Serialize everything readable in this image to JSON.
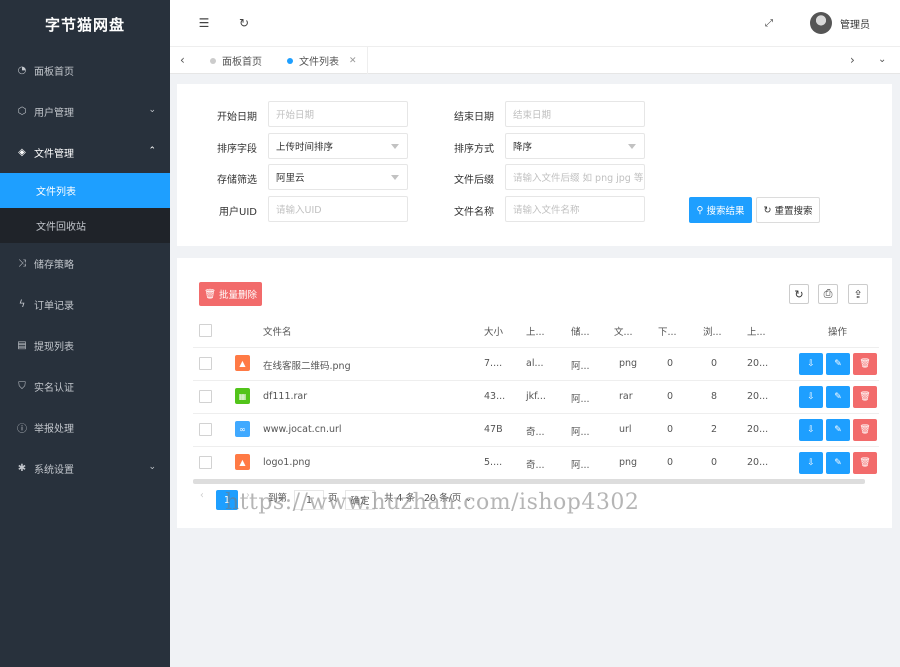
{
  "app": {
    "title": "字节猫网盘"
  },
  "sidebar": {
    "items": [
      {
        "label": "面板首页",
        "icon": "dashboard-icon"
      },
      {
        "label": "用户管理",
        "icon": "cube-icon"
      },
      {
        "label": "文件管理",
        "icon": "layers-icon"
      },
      {
        "label": "储存策略",
        "icon": "shuffle-icon"
      },
      {
        "label": "订单记录",
        "icon": "pulse-icon"
      },
      {
        "label": "提现列表",
        "icon": "list-icon"
      },
      {
        "label": "实名认证",
        "icon": "shield-icon"
      },
      {
        "label": "举报处理",
        "icon": "alert-icon"
      },
      {
        "label": "系统设置",
        "icon": "gear-icon"
      }
    ],
    "sub_items": [
      {
        "label": "文件列表"
      },
      {
        "label": "文件回收站"
      }
    ]
  },
  "header": {
    "user_name": "管理员"
  },
  "tabs": [
    {
      "label": "面板首页"
    },
    {
      "label": "文件列表"
    }
  ],
  "search": {
    "start_date": {
      "label": "开始日期",
      "placeholder": "开始日期"
    },
    "end_date": {
      "label": "结束日期",
      "placeholder": "结束日期"
    },
    "sort_field": {
      "label": "排序字段",
      "value": "上传时间排序"
    },
    "sort_order": {
      "label": "排序方式",
      "value": "降序"
    },
    "storage": {
      "label": "存储筛选",
      "value": "阿里云"
    },
    "suffix": {
      "label": "文件后缀",
      "placeholder": "请输入文件后缀 如 png jpg 等"
    },
    "uid": {
      "label": "用户UID",
      "placeholder": "请输入UID"
    },
    "filename": {
      "label": "文件名称",
      "placeholder": "请输入文件名称"
    },
    "search_button": "搜索结果",
    "reset_button": "重置搜索"
  },
  "table": {
    "batch_delete": "批量删除",
    "headers": [
      "文件名",
      "大小",
      "上...",
      "储...",
      "文...",
      "下...",
      "浏...",
      "上...",
      "操作"
    ],
    "rows": [
      {
        "name": "在线客服二维码.png",
        "size": "7....",
        "user": "al...",
        "storage": "阿...",
        "type": "png",
        "downloads": "0",
        "views": "0",
        "time": "20...",
        "icon_color": "#ff7a45"
      },
      {
        "name": "df111.rar",
        "size": "43...",
        "user": "jkf...",
        "storage": "阿...",
        "type": "rar",
        "downloads": "0",
        "views": "8",
        "time": "20...",
        "icon_color": "#52c41a"
      },
      {
        "name": "www.jocat.cn.url",
        "size": "47B",
        "user": "奇...",
        "storage": "阿...",
        "type": "url",
        "downloads": "0",
        "views": "2",
        "time": "20...",
        "icon_color": "#40a9ff"
      },
      {
        "name": "logo1.png",
        "size": "5....",
        "user": "奇...",
        "storage": "阿...",
        "type": "png",
        "downloads": "0",
        "views": "0",
        "time": "20...",
        "icon_color": "#ff7a45"
      }
    ]
  },
  "pager": {
    "current": "1",
    "goto_label": "到第",
    "goto_value": "1",
    "page_unit": "页",
    "confirm": "确定",
    "total": "共 4 条",
    "page_size": "20 条/页"
  },
  "watermark": "https://www.huzhan.com/ishop4302"
}
